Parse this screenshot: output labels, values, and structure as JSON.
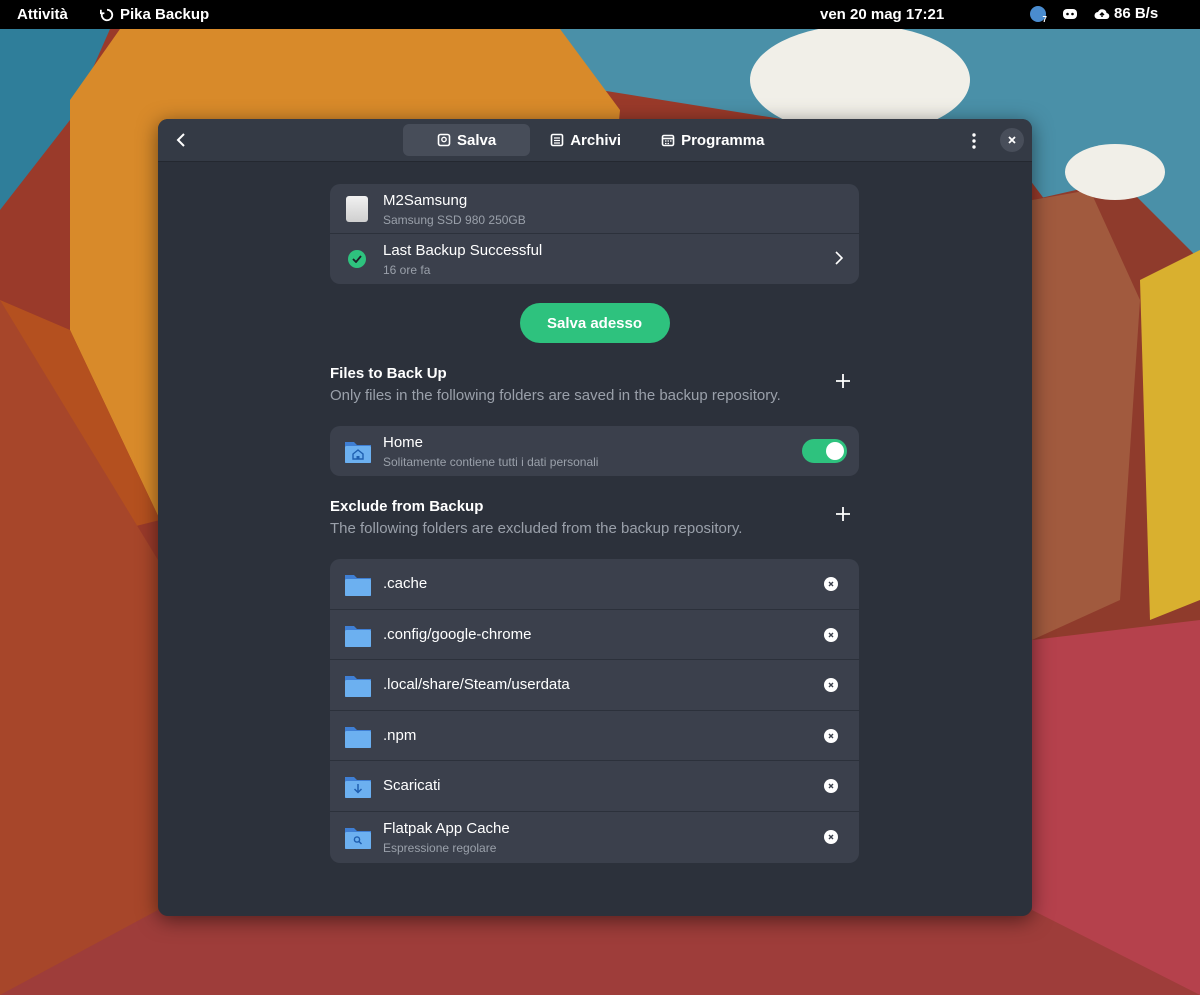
{
  "colors": {
    "accent_green": "#2ec27e",
    "window_bg": "#2c313b",
    "card_bg": "#3b404c",
    "folder_blue": "#5aa0e8"
  },
  "topbar": {
    "activities": "Attività",
    "app_name": "Pika Backup",
    "app_icon": "history-icon",
    "clock": "ven 20 mag  17:21",
    "network_speed": "86 B/s",
    "tray_badge": "7"
  },
  "window": {
    "tabs": [
      {
        "label": "Salva",
        "icon": "drive-icon",
        "active": true
      },
      {
        "label": "Archivi",
        "icon": "archive-icon",
        "active": false
      },
      {
        "label": "Programma",
        "icon": "calendar-icon",
        "active": false
      }
    ],
    "device": {
      "name": "M2Samsung",
      "model": "Samsung SSD 980 250GB"
    },
    "status": {
      "title": "Last Backup Successful",
      "time": "16 ore fa"
    },
    "save_button": "Salva adesso",
    "include": {
      "heading": "Files to Back Up",
      "description": "Only files in the following folders are saved in the backup repository.",
      "items": [
        {
          "title": "Home",
          "subtitle": "Solitamente contiene tutti i dati personali",
          "enabled": true
        }
      ]
    },
    "exclude": {
      "heading": "Exclude from Backup",
      "description": "The following folders are excluded from the backup repository.",
      "items": [
        {
          "title": ".cache",
          "subtitle": ""
        },
        {
          "title": ".config/google-chrome",
          "subtitle": ""
        },
        {
          "title": ".local/share/Steam/userdata",
          "subtitle": ""
        },
        {
          "title": ".npm",
          "subtitle": ""
        },
        {
          "title": "Scaricati",
          "subtitle": ""
        },
        {
          "title": "Flatpak App Cache",
          "subtitle": "Espressione regolare"
        }
      ]
    }
  }
}
